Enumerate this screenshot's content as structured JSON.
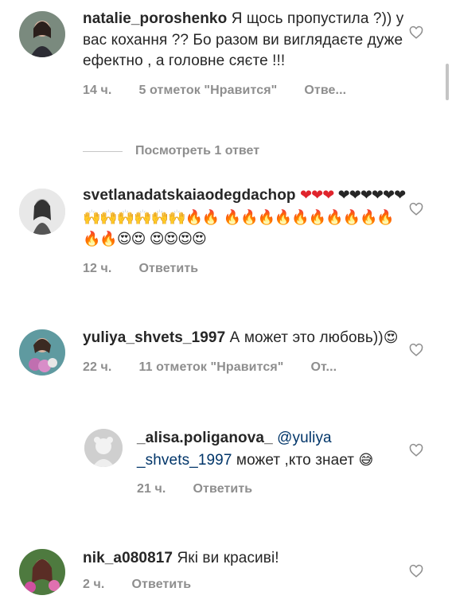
{
  "comments": [
    {
      "username": "natalie_poroshenko",
      "text": "Я щось пропустила ?)) у вас кохання ?? Бо разом ви виглядаєте дуже ефектно , а головне сяєте !!!",
      "time": "14 ч.",
      "likes": "5 отметок \"Нравится\"",
      "reply": "Отве...",
      "view_replies": "Посмотреть 1 ответ"
    },
    {
      "username": "svetlanadatskaiaodegdachop",
      "text": "",
      "emojis_line1": "❤❤❤",
      "emojis_line2": "❤❤❤❤❤❤🙌🙌🙌🙌🙌🙌🔥🔥",
      "emojis_line3": "🔥🔥🔥🔥🔥🔥🔥🔥🔥🔥🔥🔥😍😍",
      "emojis_line4": "😍😍😍😍",
      "time": "12 ч.",
      "reply": "Ответить"
    },
    {
      "username": "yuliya_shvets_1997",
      "text": "А может это любовь))",
      "emoji": "😍",
      "time": "22 ч.",
      "likes": "11 отметок \"Нравится\"",
      "reply": "От..."
    },
    {
      "username": "_alisa.poliganova_",
      "mention": "@yuliya _shvets_1997",
      "text": "может ,кто знает",
      "emoji": "😅",
      "time": "21 ч.",
      "reply": "Ответить"
    },
    {
      "username": "nik_a080817",
      "text": "Які ви красиві!",
      "time": "2 ч.",
      "reply": "Ответить"
    }
  ],
  "icons": {
    "like": "heart-outline-icon"
  },
  "colors": {
    "text": "#262626",
    "meta": "#8e8e8e",
    "mention": "#003569"
  }
}
